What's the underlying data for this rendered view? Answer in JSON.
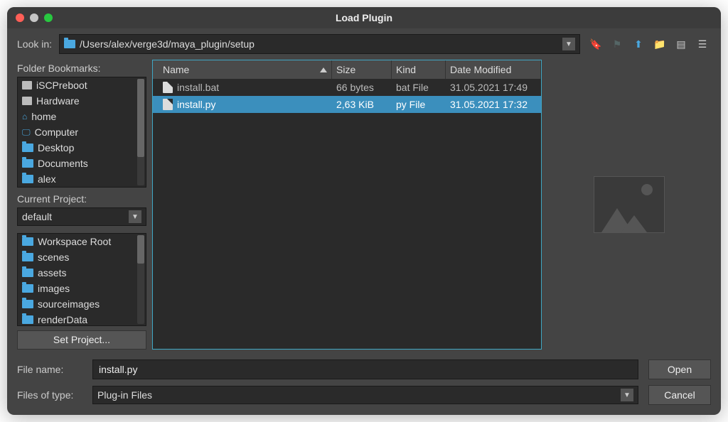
{
  "title": "Load Plugin",
  "lookin_label": "Look in:",
  "path": "/Users/alex/verge3d/maya_plugin/setup",
  "sidebar": {
    "bookmarks_label": "Folder Bookmarks:",
    "bookmarks": [
      {
        "label": "iSCPreboot",
        "icon": "disk"
      },
      {
        "label": "Hardware",
        "icon": "disk"
      },
      {
        "label": "home",
        "icon": "home"
      },
      {
        "label": "Computer",
        "icon": "monitor"
      },
      {
        "label": "Desktop",
        "icon": "folder"
      },
      {
        "label": "Documents",
        "icon": "folder"
      },
      {
        "label": "alex",
        "icon": "folder"
      }
    ],
    "project_label": "Current Project:",
    "project_value": "default",
    "workspace": [
      {
        "label": "Workspace Root",
        "icon": "folder"
      },
      {
        "label": "scenes",
        "icon": "folder"
      },
      {
        "label": "assets",
        "icon": "folder"
      },
      {
        "label": "images",
        "icon": "folder"
      },
      {
        "label": "sourceimages",
        "icon": "folder"
      },
      {
        "label": "renderData",
        "icon": "folder"
      }
    ],
    "set_project": "Set Project..."
  },
  "columns": {
    "name": "Name",
    "size": "Size",
    "kind": "Kind",
    "date": "Date Modified"
  },
  "files": [
    {
      "name": "install.bat",
      "size": "66 bytes",
      "kind": "bat File",
      "date": "31.05.2021 17:49",
      "selected": false
    },
    {
      "name": "install.py",
      "size": "2,63 KiB",
      "kind": "py File",
      "date": "31.05.2021 17:32",
      "selected": true
    }
  ],
  "footer": {
    "filename_label": "File name:",
    "filename": "install.py",
    "type_label": "Files of type:",
    "type_value": "Plug-in Files",
    "open": "Open",
    "cancel": "Cancel"
  }
}
